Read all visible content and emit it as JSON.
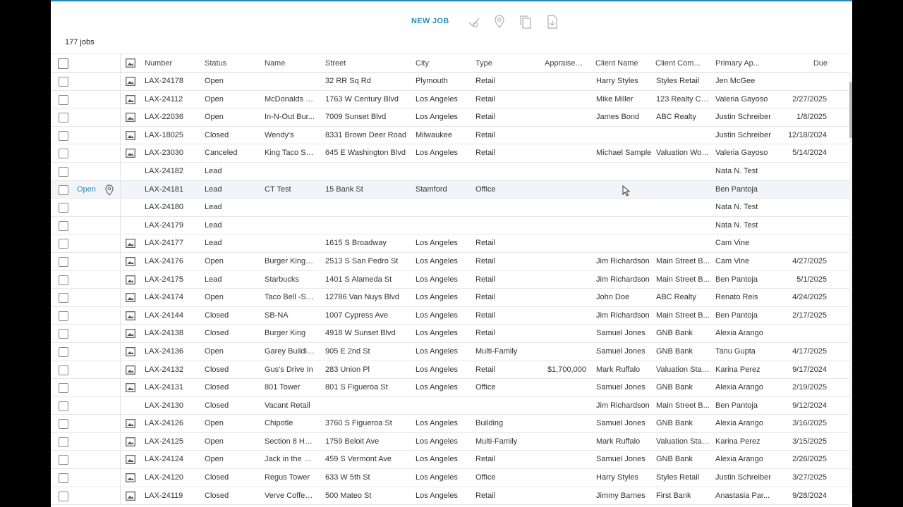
{
  "toolbar": {
    "new_job_label": "NEW JOB",
    "icons": [
      "unassign-icon",
      "location-pin-icon",
      "copy-icon",
      "export-file-icon"
    ]
  },
  "job_count_label": "177 jobs",
  "columns": [
    "Number",
    "Status",
    "Name",
    "Street",
    "City",
    "Type",
    "Appraised ...",
    "Client Name",
    "Client Com...",
    "Primary Ap...",
    "Due"
  ],
  "hover_row": {
    "open_label": "Open"
  },
  "rows": [
    {
      "img": true,
      "number": "LAX-24178",
      "status": "Open",
      "name": "",
      "street": "32 RR Sq Rd",
      "city": "Plymouth",
      "type": "Retail",
      "appraised": "",
      "client": "Harry Styles",
      "client_co": "Styles Retail",
      "primary": "Jen McGee",
      "due": ""
    },
    {
      "img": true,
      "number": "LAX-24112",
      "status": "Open",
      "name": "McDonalds - ...",
      "street": "1763 W Century Blvd",
      "city": "Los Angeles",
      "type": "Retail",
      "appraised": "",
      "client": "Mike Miller",
      "client_co": "123 Realty Co...",
      "primary": "Valeria Gayoso",
      "due": "2/27/2025"
    },
    {
      "img": true,
      "number": "LAX-22036",
      "status": "Open",
      "name": "In-N-Out Bur...",
      "street": "7009 Sunset Blvd",
      "city": "Los Angeles",
      "type": "Retail",
      "appraised": "",
      "client": "James Bond",
      "client_co": "ABC Realty",
      "primary": "Justin Schreiber",
      "due": "1/8/2025"
    },
    {
      "img": true,
      "number": "LAX-18025",
      "status": "Closed",
      "name": "Wendy's",
      "street": "8331 Brown Deer Road",
      "city": "Milwaukee",
      "type": "Retail",
      "appraised": "",
      "client": "",
      "client_co": "",
      "primary": "Justin Schreiber",
      "due": "12/18/2024"
    },
    {
      "img": true,
      "number": "LAX-23030",
      "status": "Canceled",
      "name": "King Taco Sa...",
      "street": "645 E Washington Blvd",
      "city": "Los Angeles",
      "type": "Retail",
      "appraised": "",
      "client": "Michael Sample",
      "client_co": "Valuation Wor...",
      "primary": "Valeria Gayoso",
      "due": "5/14/2024"
    },
    {
      "img": false,
      "number": "LAX-24182",
      "status": "Lead",
      "name": "",
      "street": "",
      "city": "",
      "type": "",
      "appraised": "",
      "client": "",
      "client_co": "",
      "primary": "Nata N. Test",
      "due": ""
    },
    {
      "img": false,
      "hover": true,
      "number": "LAX-24181",
      "status": "Lead",
      "name": "CT Test",
      "street": "15 Bank St",
      "city": "Stamford",
      "type": "Office",
      "appraised": "",
      "client": "",
      "client_co": "",
      "primary": "Ben Pantoja",
      "due": ""
    },
    {
      "img": false,
      "number": "LAX-24180",
      "status": "Lead",
      "name": "",
      "street": "",
      "city": "",
      "type": "",
      "appraised": "",
      "client": "",
      "client_co": "",
      "primary": "Nata N. Test",
      "due": ""
    },
    {
      "img": false,
      "number": "LAX-24179",
      "status": "Lead",
      "name": "",
      "street": "",
      "city": "",
      "type": "",
      "appraised": "",
      "client": "",
      "client_co": "",
      "primary": "Nata N. Test",
      "due": ""
    },
    {
      "img": true,
      "number": "LAX-24177",
      "status": "Lead",
      "name": "",
      "street": "1615 S Broadway",
      "city": "Los Angeles",
      "type": "Retail",
      "appraised": "",
      "client": "",
      "client_co": "",
      "primary": "Cam Vine",
      "due": ""
    },
    {
      "img": true,
      "number": "LAX-24176",
      "status": "Open",
      "name": "Burger King - ...",
      "street": "2513 S San Pedro St",
      "city": "Los Angeles",
      "type": "Retail",
      "appraised": "",
      "client": "Jim Richardson",
      "client_co": "Main Street B...",
      "primary": "Cam Vine",
      "due": "4/27/2025"
    },
    {
      "img": true,
      "number": "LAX-24175",
      "status": "Lead",
      "name": "Starbucks",
      "street": "1401 S Alameda St",
      "city": "Los Angeles",
      "type": "Retail",
      "appraised": "",
      "client": "Jim Richardson",
      "client_co": "Main Street B...",
      "primary": "Ben Pantoja",
      "due": "5/1/2025"
    },
    {
      "img": true,
      "number": "LAX-24174",
      "status": "Open",
      "name": "Taco Bell -Sa...",
      "street": "12786 Van Nuys Blvd",
      "city": "Los Angeles",
      "type": "Retail",
      "appraised": "",
      "client": "John Doe",
      "client_co": "ABC Realty",
      "primary": "Renato Reis",
      "due": "4/24/2025"
    },
    {
      "img": true,
      "number": "LAX-24144",
      "status": "Closed",
      "name": "SB-NA",
      "street": "1007 Cypress Ave",
      "city": "Los Angeles",
      "type": "Retail",
      "appraised": "",
      "client": "Jim Richardson",
      "client_co": "Main Street B...",
      "primary": "Ben Pantoja",
      "due": "2/17/2025"
    },
    {
      "img": true,
      "number": "LAX-24138",
      "status": "Closed",
      "name": "Burger King",
      "street": "4918 W Sunset Blvd",
      "city": "Los Angeles",
      "type": "Retail",
      "appraised": "",
      "client": "Samuel Jones",
      "client_co": "GNB Bank",
      "primary": "Alexia Arango",
      "due": ""
    },
    {
      "img": true,
      "number": "LAX-24136",
      "status": "Open",
      "name": "Garey Building",
      "street": "905 E 2nd St",
      "city": "Los Angeles",
      "type": "Multi-Family",
      "appraised": "",
      "client": "Samuel Jones",
      "client_co": "GNB Bank",
      "primary": "Tanu Gupta",
      "due": "4/17/2025"
    },
    {
      "img": true,
      "number": "LAX-24132",
      "status": "Closed",
      "name": "Gus's Drive In",
      "street": "283 Union Pl",
      "city": "Los Angeles",
      "type": "Retail",
      "appraised": "$1,700,000",
      "client": "Mark Ruffalo",
      "client_co": "Valuation Stat...",
      "primary": "Karina Perez",
      "due": "9/17/2024"
    },
    {
      "img": true,
      "number": "LAX-24131",
      "status": "Closed",
      "name": "801 Tower",
      "street": "801 S Figueroa St",
      "city": "Los Angeles",
      "type": "Office",
      "appraised": "",
      "client": "Samuel Jones",
      "client_co": "GNB Bank",
      "primary": "Alexia Arango",
      "due": "2/19/2025"
    },
    {
      "img": false,
      "number": "LAX-24130",
      "status": "Closed",
      "name": "Vacant Retail",
      "street": "",
      "city": "",
      "type": "",
      "appraised": "",
      "client": "Jim Richardson",
      "client_co": "Main Street B...",
      "primary": "Ben Pantoja",
      "due": "9/12/2024"
    },
    {
      "img": true,
      "number": "LAX-24126",
      "status": "Open",
      "name": "Chipotle",
      "street": "3760 S Figueroa St",
      "city": "Los Angeles",
      "type": "Building",
      "appraised": "",
      "client": "Samuel Jones",
      "client_co": "GNB Bank",
      "primary": "Alexia Arango",
      "due": "3/16/2025"
    },
    {
      "img": true,
      "number": "LAX-24125",
      "status": "Open",
      "name": "Section 8 Hou...",
      "street": "1759 Beloit Ave",
      "city": "Los Angeles",
      "type": "Multi-Family",
      "appraised": "",
      "client": "Mark Ruffalo",
      "client_co": "Valuation Stat...",
      "primary": "Karina Perez",
      "due": "3/15/2025"
    },
    {
      "img": true,
      "number": "LAX-24124",
      "status": "Open",
      "name": "Jack in the bo...",
      "street": "459 S Vermont Ave",
      "city": "Los Angeles",
      "type": "Retail",
      "appraised": "",
      "client": "Samuel Jones",
      "client_co": "GNB Bank",
      "primary": "Alexia Arango",
      "due": "2/26/2025"
    },
    {
      "img": true,
      "number": "LAX-24120",
      "status": "Closed",
      "name": "Regus Tower",
      "street": "633 W 5th St",
      "city": "Los Angeles",
      "type": "Office",
      "appraised": "",
      "client": "Harry Styles",
      "client_co": "Styles Retail",
      "primary": "Justin Schreiber",
      "due": "3/27/2025"
    },
    {
      "img": true,
      "number": "LAX-24119",
      "status": "Closed",
      "name": "Verve Coffee ...",
      "street": "500 Mateo St",
      "city": "Los Angeles",
      "type": "Retail",
      "appraised": "",
      "client": "Jimmy Barnes",
      "client_co": "First Bank",
      "primary": "Anastasia Par...",
      "due": "9/28/2024"
    }
  ]
}
